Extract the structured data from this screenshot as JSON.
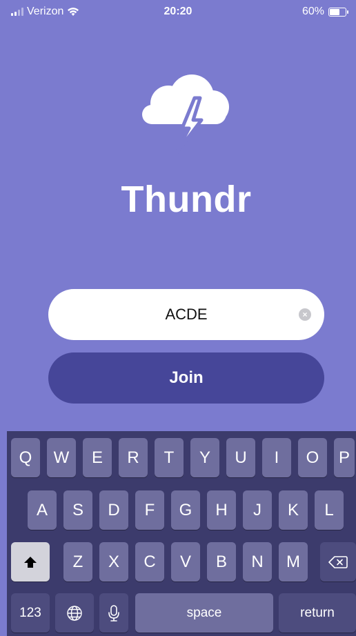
{
  "status_bar": {
    "carrier": "Verizon",
    "time": "20:20",
    "battery": "60%",
    "battery_level": 0.6
  },
  "app": {
    "title": "Thundr",
    "code_input_value": "ACDE",
    "join_label": "Join"
  },
  "keyboard": {
    "row1": [
      "Q",
      "W",
      "E",
      "R",
      "T",
      "Y",
      "U",
      "I",
      "O",
      "P"
    ],
    "row2": [
      "A",
      "S",
      "D",
      "F",
      "G",
      "H",
      "J",
      "K",
      "L"
    ],
    "row3": [
      "Z",
      "X",
      "C",
      "V",
      "B",
      "N",
      "M"
    ],
    "numbers_label": "123",
    "space_label": "space",
    "return_label": "return"
  },
  "colors": {
    "background": "#7b7bcf",
    "join_button": "#464699",
    "keyboard": "#3c3b6c"
  }
}
